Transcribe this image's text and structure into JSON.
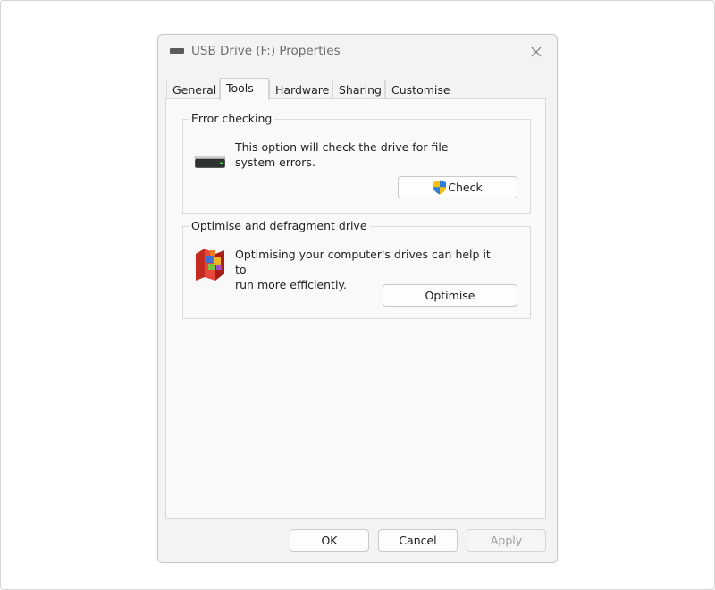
{
  "window": {
    "title": "USB Drive (F:) Properties",
    "close_icon": "close-icon"
  },
  "tabs": [
    {
      "label": "General"
    },
    {
      "label": "Tools",
      "active": true
    },
    {
      "label": "Hardware"
    },
    {
      "label": "Sharing"
    },
    {
      "label": "Customise"
    }
  ],
  "error_checking": {
    "legend": "Error checking",
    "description_line1": "This option will check the drive for file",
    "description_line2": "system errors.",
    "icon": "hard-drive-icon",
    "button_label": "Check",
    "button_icon": "uac-shield-icon"
  },
  "optimise": {
    "legend": "Optimise and defragment drive",
    "description_line1": "Optimising your computer's drives can help it to",
    "description_line2": "run more efficiently.",
    "icon": "defragment-icon",
    "button_label": "Optimise"
  },
  "footer": {
    "ok_label": "OK",
    "cancel_label": "Cancel",
    "apply_label": "Apply"
  }
}
